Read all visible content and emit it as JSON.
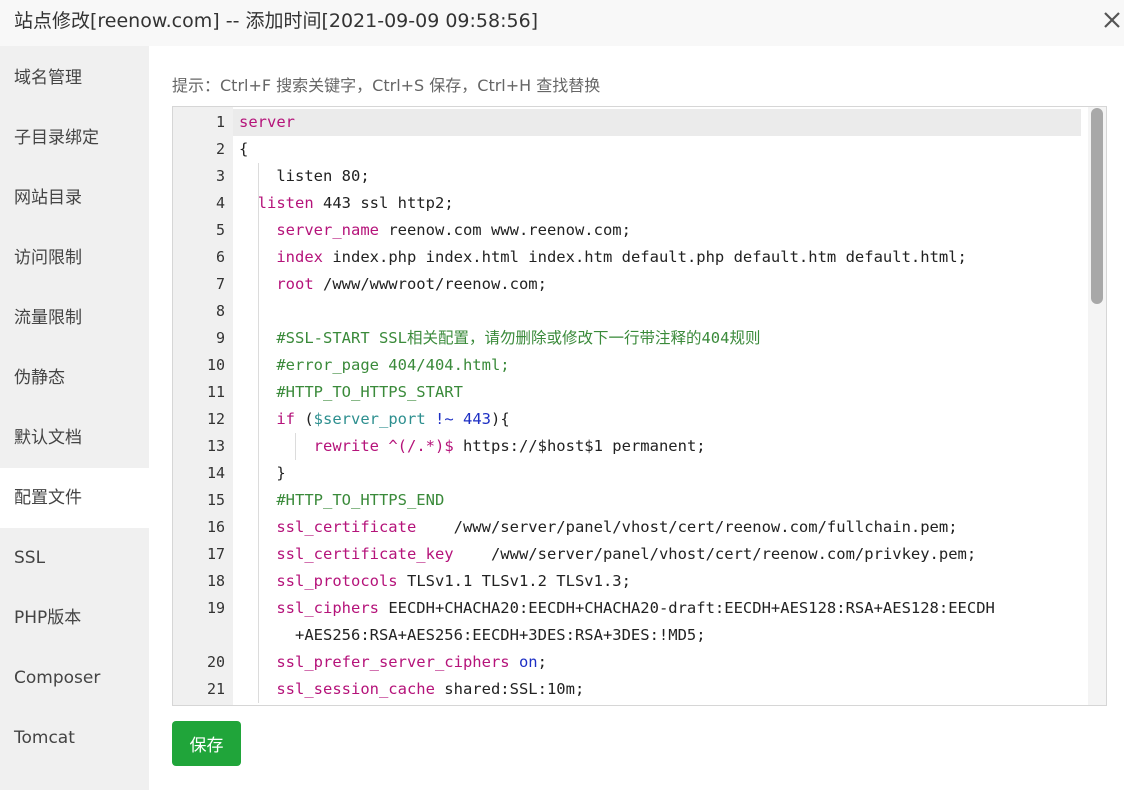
{
  "title": "站点修改[reenow.com] -- 添加时间[2021-09-09 09:58:56]",
  "close_icon": "close-icon",
  "sidebar": {
    "items": [
      {
        "label": "域名管理"
      },
      {
        "label": "子目录绑定"
      },
      {
        "label": "网站目录"
      },
      {
        "label": "访问限制"
      },
      {
        "label": "流量限制"
      },
      {
        "label": "伪静态"
      },
      {
        "label": "默认文档"
      },
      {
        "label": "配置文件"
      },
      {
        "label": "SSL"
      },
      {
        "label": "PHP版本"
      },
      {
        "label": "Composer"
      },
      {
        "label": "Tomcat"
      }
    ],
    "active": "配置文件"
  },
  "hint": "提示：Ctrl+F 搜索关键字，Ctrl+S 保存，Ctrl+H 查找替换",
  "editor": {
    "lines": [
      {
        "n": "1",
        "t": "server"
      },
      {
        "n": "2",
        "t": "{"
      },
      {
        "n": "3",
        "t": "    listen 80;"
      },
      {
        "n": "4",
        "t": "  listen 443 ssl http2;"
      },
      {
        "n": "5",
        "t": "    server_name reenow.com www.reenow.com;"
      },
      {
        "n": "6",
        "t": "    index index.php index.html index.htm default.php default.htm default.html;"
      },
      {
        "n": "7",
        "t": "    root /www/wwwroot/reenow.com;"
      },
      {
        "n": "8",
        "t": ""
      },
      {
        "n": "9",
        "t": "    #SSL-START SSL相关配置，请勿删除或修改下一行带注释的404规则"
      },
      {
        "n": "10",
        "t": "    #error_page 404/404.html;"
      },
      {
        "n": "11",
        "t": "    #HTTP_TO_HTTPS_START"
      },
      {
        "n": "12",
        "t": "    if ($server_port !~ 443){"
      },
      {
        "n": "13",
        "t": "        rewrite ^(/.*)$ https://$host$1 permanent;"
      },
      {
        "n": "14",
        "t": "    }"
      },
      {
        "n": "15",
        "t": "    #HTTP_TO_HTTPS_END"
      },
      {
        "n": "16",
        "t": "    ssl_certificate    /www/server/panel/vhost/cert/reenow.com/fullchain.pem;"
      },
      {
        "n": "17",
        "t": "    ssl_certificate_key    /www/server/panel/vhost/cert/reenow.com/privkey.pem;"
      },
      {
        "n": "18",
        "t": "    ssl_protocols TLSv1.1 TLSv1.2 TLSv1.3;"
      },
      {
        "n": "19",
        "t": "    ssl_ciphers EECDH+CHACHA20:EECDH+CHACHA20-draft:EECDH+AES128:RSA+AES128:EECDH"
      },
      {
        "n": "",
        "t": "      +AES256:RSA+AES256:EECDH+3DES:RSA+3DES:!MD5;"
      },
      {
        "n": "20",
        "t": "    ssl_prefer_server_ciphers on;"
      },
      {
        "n": "21",
        "t": "    ssl_session_cache shared:SSL:10m;"
      }
    ]
  },
  "save_label": "保存",
  "colors": {
    "accent": "#20a53a",
    "keyword": "#b5137a",
    "comment": "#3a8a3a",
    "variable": "#2d8f8f",
    "number": "#1d2fc4"
  }
}
